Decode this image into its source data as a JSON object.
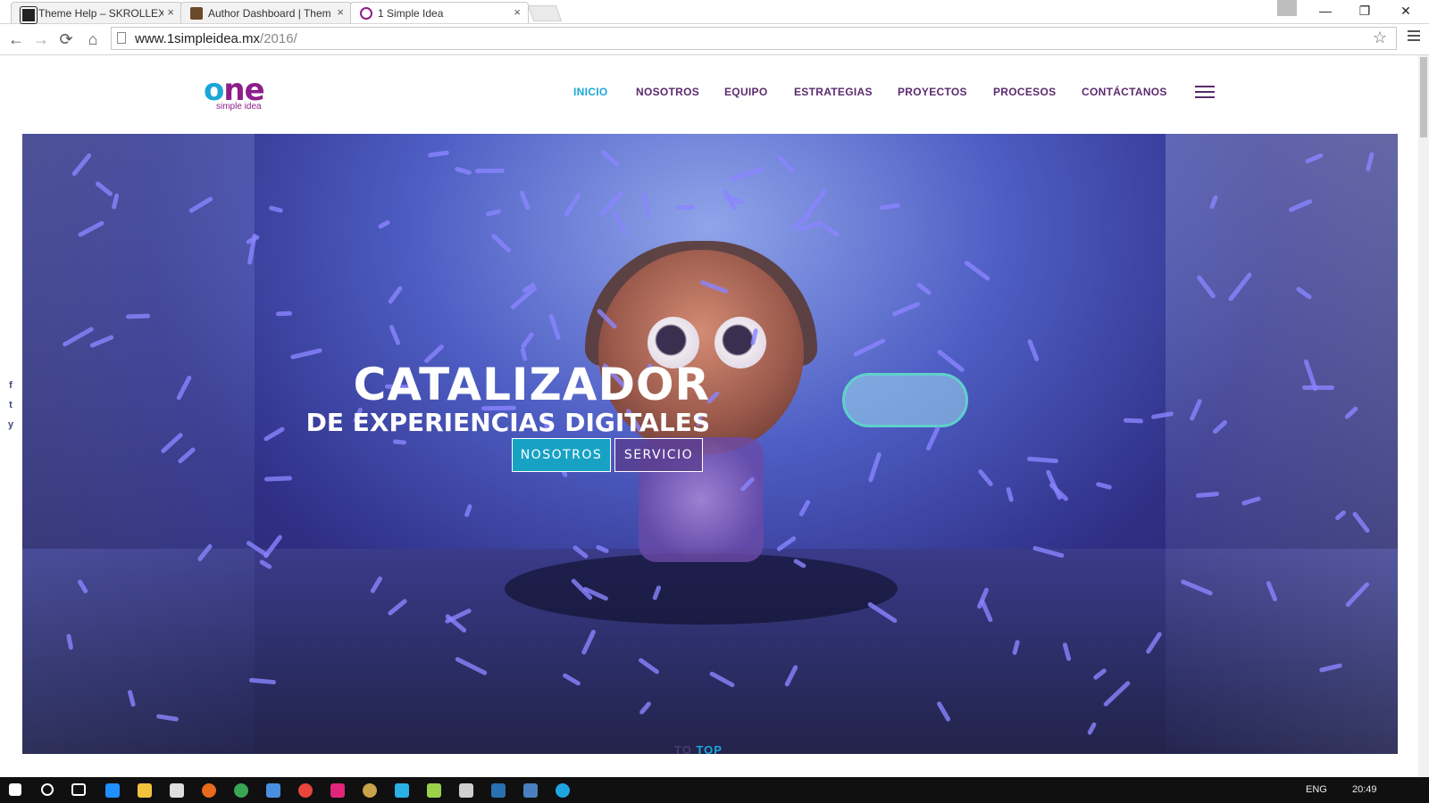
{
  "browser": {
    "tabs": [
      {
        "title": "Theme Help – SKROLLEX",
        "active": false
      },
      {
        "title": "Author Dashboard | Them",
        "active": false
      },
      {
        "title": "1 Simple Idea",
        "active": true
      }
    ],
    "tab_close": "×",
    "url_host": "www.1simpleidea.mx",
    "url_path": "/2016/",
    "window_controls": {
      "minimize": "—",
      "restore": "❐",
      "close": "✕"
    },
    "nav": {
      "back": "←",
      "forward": "→",
      "reload": "⟳",
      "home": "⌂",
      "star": "☆"
    }
  },
  "site": {
    "logo_word": "ne",
    "logo_o": "o",
    "logo_tagline": "simple idea",
    "nav": [
      {
        "label": "INICIO",
        "active": true
      },
      {
        "label": "NOSOTROS",
        "active": false
      },
      {
        "label": "EQUIPO",
        "active": false
      },
      {
        "label": "ESTRATEGIAS",
        "active": false
      },
      {
        "label": "PROYECTOS",
        "active": false
      },
      {
        "label": "PROCESOS",
        "active": false
      },
      {
        "label": "CONTÁCTANOS",
        "active": false
      }
    ],
    "hero": {
      "title": "CATALIZADOR",
      "subtitle": "DE EXPERIENCIAS DIGITALES",
      "button_primary": "NOSOTROS",
      "button_secondary": "SERVICIO"
    },
    "social": [
      "f",
      "t",
      "y"
    ],
    "to_top_prefix": "TO",
    "to_top_word": "TOP",
    "colors": {
      "accent": "#1ba6d9",
      "brand": "#5b2a6e",
      "button_primary": "#17a2c4"
    }
  },
  "taskbar": {
    "language": "ENG",
    "clock": "20:49"
  }
}
